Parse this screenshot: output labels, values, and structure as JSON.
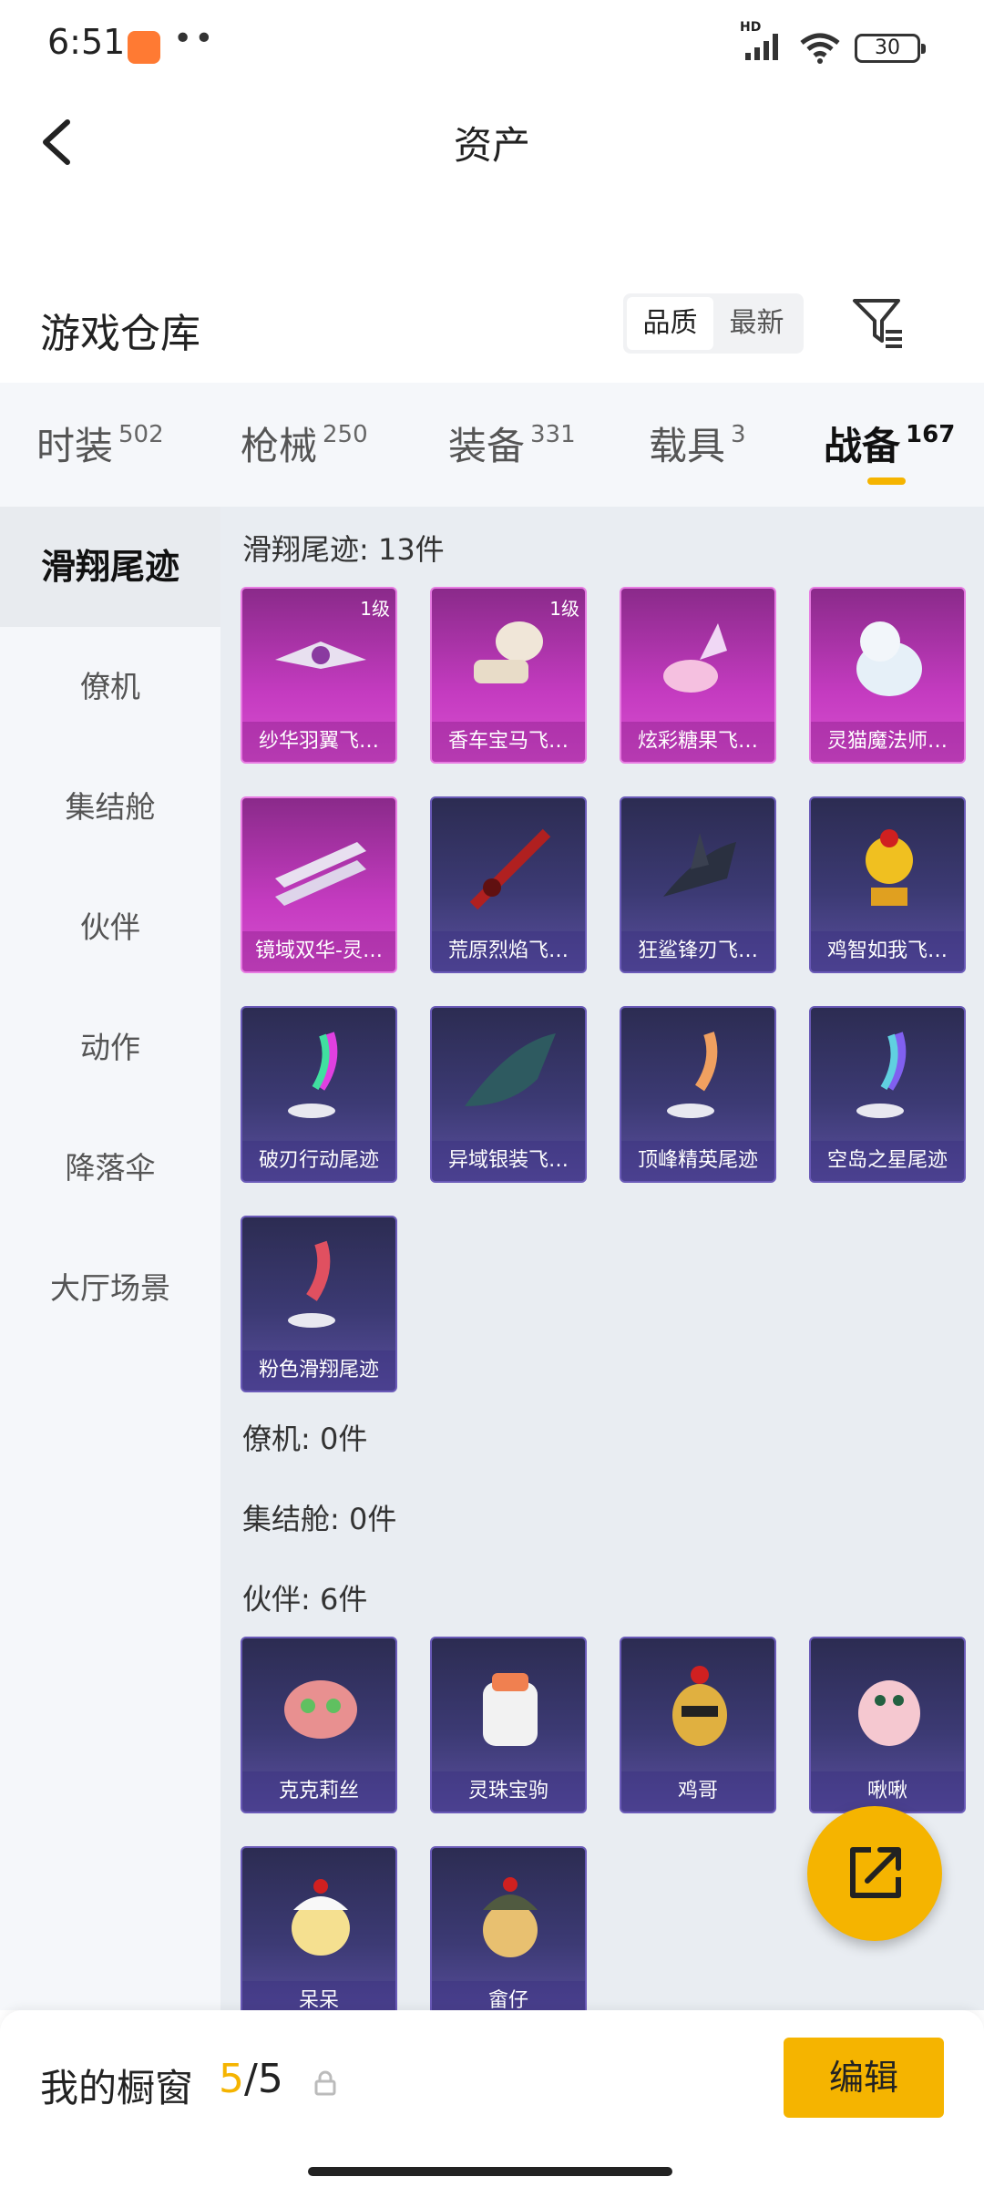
{
  "status_bar": {
    "time": "6:51",
    "dots": "••",
    "network_label": "HD",
    "battery": "30"
  },
  "header": {
    "title": "资产"
  },
  "warehouse": {
    "title": "游戏仓库",
    "sort_options": [
      "品质",
      "最新"
    ],
    "sort_selected": "品质"
  },
  "tabs": [
    {
      "label": "时装",
      "count": "502"
    },
    {
      "label": "枪械",
      "count": "250"
    },
    {
      "label": "装备",
      "count": "331"
    },
    {
      "label": "载具",
      "count": "3"
    },
    {
      "label": "战备",
      "count": "167",
      "active": true
    }
  ],
  "sidebar": {
    "items": [
      {
        "label": "滑翔尾迹",
        "active": true
      },
      {
        "label": "僚机"
      },
      {
        "label": "集结舱"
      },
      {
        "label": "伙伴"
      },
      {
        "label": "动作"
      },
      {
        "label": "降落伞"
      },
      {
        "label": "大厅场景"
      }
    ]
  },
  "sections": {
    "glide": {
      "title": "滑翔尾迹: 13件",
      "items": [
        {
          "name": "纱华羽翼飞…",
          "level": "1级",
          "rarity": "pink"
        },
        {
          "name": "香车宝马飞…",
          "level": "1级",
          "rarity": "pink"
        },
        {
          "name": "炫彩糖果飞…",
          "rarity": "pink"
        },
        {
          "name": "灵猫魔法师…",
          "rarity": "pink"
        },
        {
          "name": "镜域双华-灵…",
          "rarity": "pink"
        },
        {
          "name": "荒原烈焰飞…",
          "rarity": "blue"
        },
        {
          "name": "狂鲨锋刃飞…",
          "rarity": "blue"
        },
        {
          "name": "鸡智如我飞…",
          "rarity": "blue"
        },
        {
          "name": "破刃行动尾迹",
          "rarity": "blue"
        },
        {
          "name": "异域银装飞…",
          "rarity": "blue"
        },
        {
          "name": "顶峰精英尾迹",
          "rarity": "blue"
        },
        {
          "name": "空岛之星尾迹",
          "rarity": "blue"
        },
        {
          "name": "粉色滑翔尾迹",
          "rarity": "blue"
        }
      ]
    },
    "wingman": {
      "title": "僚机: 0件"
    },
    "pod": {
      "title": "集结舱: 0件"
    },
    "partner": {
      "title": "伙伴: 6件",
      "items": [
        {
          "name": "克克莉丝",
          "rarity": "blue"
        },
        {
          "name": "灵珠宝驹",
          "rarity": "blue"
        },
        {
          "name": "鸡哥",
          "rarity": "blue"
        },
        {
          "name": "啾啾",
          "rarity": "blue"
        },
        {
          "name": "呆呆",
          "rarity": "blue"
        },
        {
          "name": "畲仔",
          "rarity": "blue"
        }
      ]
    }
  },
  "bottom_bar": {
    "showcase_label": "我的橱窗",
    "showcase_used": "5",
    "showcase_total": "/5",
    "edit_label": "编辑"
  },
  "colors": {
    "accent": "#f5b400",
    "pink_rarity": "#c43bc0",
    "blue_rarity": "#3c3a74"
  },
  "icons": [
    "back-arrow-icon",
    "filter-icon",
    "lock-icon",
    "share-icon",
    "wifi-icon",
    "signal-icon",
    "battery-icon"
  ]
}
